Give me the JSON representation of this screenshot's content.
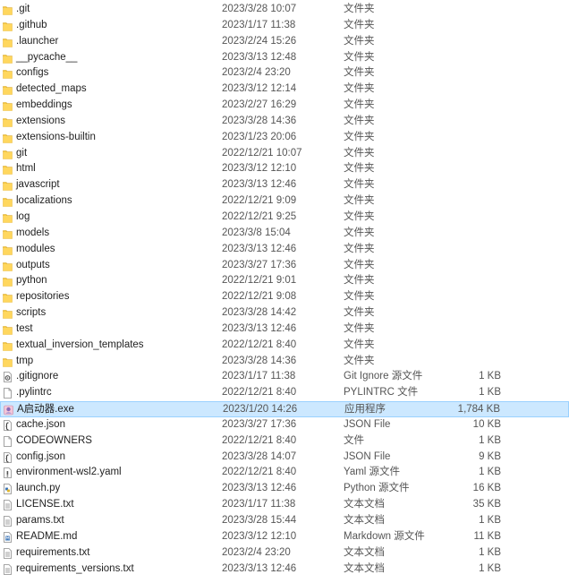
{
  "files": [
    {
      "name": ".git",
      "date": "2023/3/28 10:07",
      "type": "文件夹",
      "size": "",
      "icon": "folder-icon"
    },
    {
      "name": ".github",
      "date": "2023/1/17 11:38",
      "type": "文件夹",
      "size": "",
      "icon": "folder-icon"
    },
    {
      "name": ".launcher",
      "date": "2023/2/24 15:26",
      "type": "文件夹",
      "size": "",
      "icon": "folder-icon"
    },
    {
      "name": "__pycache__",
      "date": "2023/3/13 12:48",
      "type": "文件夹",
      "size": "",
      "icon": "folder-icon"
    },
    {
      "name": "configs",
      "date": "2023/2/4 23:20",
      "type": "文件夹",
      "size": "",
      "icon": "folder-icon"
    },
    {
      "name": "detected_maps",
      "date": "2023/3/12 12:14",
      "type": "文件夹",
      "size": "",
      "icon": "folder-icon"
    },
    {
      "name": "embeddings",
      "date": "2023/2/27 16:29",
      "type": "文件夹",
      "size": "",
      "icon": "folder-icon"
    },
    {
      "name": "extensions",
      "date": "2023/3/28 14:36",
      "type": "文件夹",
      "size": "",
      "icon": "folder-icon"
    },
    {
      "name": "extensions-builtin",
      "date": "2023/1/23 20:06",
      "type": "文件夹",
      "size": "",
      "icon": "folder-icon"
    },
    {
      "name": "git",
      "date": "2022/12/21 10:07",
      "type": "文件夹",
      "size": "",
      "icon": "folder-icon"
    },
    {
      "name": "html",
      "date": "2023/3/12 12:10",
      "type": "文件夹",
      "size": "",
      "icon": "folder-icon"
    },
    {
      "name": "javascript",
      "date": "2023/3/13 12:46",
      "type": "文件夹",
      "size": "",
      "icon": "folder-icon"
    },
    {
      "name": "localizations",
      "date": "2022/12/21 9:09",
      "type": "文件夹",
      "size": "",
      "icon": "folder-icon"
    },
    {
      "name": "log",
      "date": "2022/12/21 9:25",
      "type": "文件夹",
      "size": "",
      "icon": "folder-icon"
    },
    {
      "name": "models",
      "date": "2023/3/8 15:04",
      "type": "文件夹",
      "size": "",
      "icon": "folder-icon"
    },
    {
      "name": "modules",
      "date": "2023/3/13 12:46",
      "type": "文件夹",
      "size": "",
      "icon": "folder-icon"
    },
    {
      "name": "outputs",
      "date": "2023/3/27 17:36",
      "type": "文件夹",
      "size": "",
      "icon": "folder-icon"
    },
    {
      "name": "python",
      "date": "2022/12/21 9:01",
      "type": "文件夹",
      "size": "",
      "icon": "folder-icon"
    },
    {
      "name": "repositories",
      "date": "2022/12/21 9:08",
      "type": "文件夹",
      "size": "",
      "icon": "folder-icon"
    },
    {
      "name": "scripts",
      "date": "2023/3/28 14:42",
      "type": "文件夹",
      "size": "",
      "icon": "folder-icon"
    },
    {
      "name": "test",
      "date": "2023/3/13 12:46",
      "type": "文件夹",
      "size": "",
      "icon": "folder-icon"
    },
    {
      "name": "textual_inversion_templates",
      "date": "2022/12/21 8:40",
      "type": "文件夹",
      "size": "",
      "icon": "folder-icon"
    },
    {
      "name": "tmp",
      "date": "2023/3/28 14:36",
      "type": "文件夹",
      "size": "",
      "icon": "folder-icon"
    },
    {
      "name": ".gitignore",
      "date": "2023/1/17 11:38",
      "type": "Git Ignore 源文件",
      "size": "1 KB",
      "icon": "gear-file-icon"
    },
    {
      "name": ".pylintrc",
      "date": "2022/12/21 8:40",
      "type": "PYLINTRC 文件",
      "size": "1 KB",
      "icon": "file-icon"
    },
    {
      "name": "A启动器.exe",
      "date": "2023/1/20 14:26",
      "type": "应用程序",
      "size": "1,784 KB",
      "icon": "app-icon",
      "selected": true
    },
    {
      "name": "cache.json",
      "date": "2023/3/27 17:36",
      "type": "JSON File",
      "size": "10 KB",
      "icon": "json-file-icon"
    },
    {
      "name": "CODEOWNERS",
      "date": "2022/12/21 8:40",
      "type": "文件",
      "size": "1 KB",
      "icon": "file-icon"
    },
    {
      "name": "config.json",
      "date": "2023/3/28 14:07",
      "type": "JSON File",
      "size": "9 KB",
      "icon": "json-file-icon"
    },
    {
      "name": "environment-wsl2.yaml",
      "date": "2022/12/21 8:40",
      "type": "Yaml 源文件",
      "size": "1 KB",
      "icon": "yaml-file-icon"
    },
    {
      "name": "launch.py",
      "date": "2023/3/13 12:46",
      "type": "Python 源文件",
      "size": "16 KB",
      "icon": "python-file-icon"
    },
    {
      "name": "LICENSE.txt",
      "date": "2023/1/17 11:38",
      "type": "文本文档",
      "size": "35 KB",
      "icon": "text-file-icon"
    },
    {
      "name": "params.txt",
      "date": "2023/3/28 15:44",
      "type": "文本文档",
      "size": "1 KB",
      "icon": "text-file-icon"
    },
    {
      "name": "README.md",
      "date": "2023/3/12 12:10",
      "type": "Markdown 源文件",
      "size": "11 KB",
      "icon": "markdown-file-icon"
    },
    {
      "name": "requirements.txt",
      "date": "2023/2/4 23:20",
      "type": "文本文档",
      "size": "1 KB",
      "icon": "text-file-icon"
    },
    {
      "name": "requirements_versions.txt",
      "date": "2023/3/13 12:46",
      "type": "文本文档",
      "size": "1 KB",
      "icon": "text-file-icon"
    }
  ],
  "colors": {
    "folder": "#f5c842",
    "selection_bg": "#cce8ff",
    "selection_border": "#99d1ff"
  }
}
